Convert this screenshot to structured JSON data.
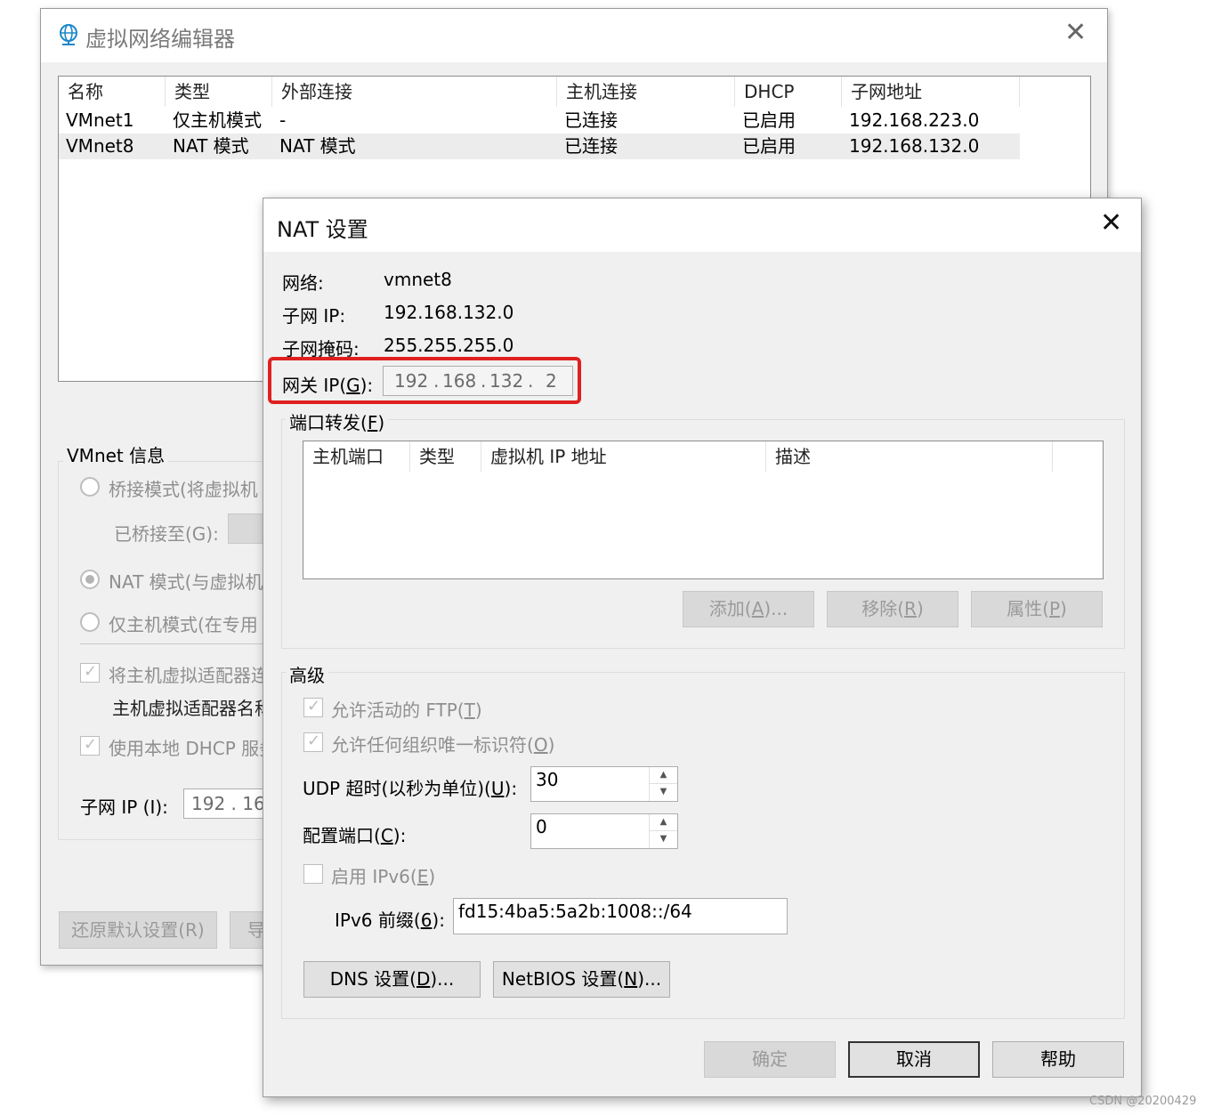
{
  "editor": {
    "title": "虚拟网络编辑器",
    "columns": [
      "名称",
      "类型",
      "外部连接",
      "主机连接",
      "DHCP",
      "子网地址"
    ],
    "rows": [
      [
        "VMnet1",
        "仅主机模式",
        "-",
        "已连接",
        "已启用",
        "192.168.223.0"
      ],
      [
        "VMnet8",
        "NAT 模式",
        "NAT 模式",
        "已连接",
        "已启用",
        "192.168.132.0"
      ]
    ],
    "info_group": "VMnet 信息",
    "bridged_radio": "桥接模式(将虚拟机",
    "bridged_to": "已桥接至(G):",
    "nat_radio": "NAT 模式(与虚拟机",
    "hostonly_radio": "仅主机模式(在专用",
    "connect_adapter": "将主机虚拟适配器连",
    "adapter_name": "主机虚拟适配器名称",
    "use_dhcp": "使用本地 DHCP 服务",
    "subnet_ip_label": "子网 IP (I):",
    "subnet_ip_partial": "192 . 168",
    "restore_defaults": "还原默认设置(R)",
    "second_button_partial": "导"
  },
  "nat": {
    "title": "NAT 设置",
    "network_label": "网络:",
    "network_value": "vmnet8",
    "subnet_ip_label": "子网 IP:",
    "subnet_ip_value": "192.168.132.0",
    "mask_label": "子网掩码:",
    "mask_value": "255.255.255.0",
    "gateway_label_pre": "网关 IP(",
    "gateway_label_key": "G",
    "gateway_label_post": "):",
    "gateway_octets": [
      "192",
      "168",
      "132",
      "2"
    ],
    "port_forward_pre": "端口转发(",
    "port_forward_key": "F",
    "port_forward_post": ")",
    "pf_columns": [
      "主机端口",
      "类型",
      "虚拟机 IP 地址",
      "描述"
    ],
    "add_pre": "添加(",
    "add_key": "A",
    "add_post": ")...",
    "remove_pre": "移除(",
    "remove_key": "R",
    "remove_post": ")",
    "props_pre": "属性(",
    "props_key": "P",
    "props_post": ")",
    "advanced": "高级",
    "ftp_pre": "允许活动的 FTP(",
    "ftp_key": "T",
    "ftp_post": ")",
    "oui_pre": "允许任何组织唯一标识符(",
    "oui_key": "O",
    "oui_post": ")",
    "udp_pre": "UDP 超时(以秒为单位)(",
    "udp_key": "U",
    "udp_post": "):",
    "udp_value": "30",
    "cfg_pre": "配置端口(",
    "cfg_key": "C",
    "cfg_post": "):",
    "cfg_value": "0",
    "ipv6_pre": "启用 IPv6(",
    "ipv6_key": "E",
    "ipv6_post": ")",
    "prefix_pre": "IPv6 前缀(",
    "prefix_key": "6",
    "prefix_post": "):",
    "prefix_value": "fd15:4ba5:5a2b:1008::/64",
    "dns_pre": "DNS 设置(",
    "dns_key": "D",
    "dns_post": ")...",
    "netbios_pre": "NetBIOS 设置(",
    "netbios_key": "N",
    "netbios_post": ")...",
    "ok": "确定",
    "cancel": "取消",
    "help": "帮助"
  },
  "watermark": "CSDN @20200429",
  "highlight_color": "#e02020"
}
